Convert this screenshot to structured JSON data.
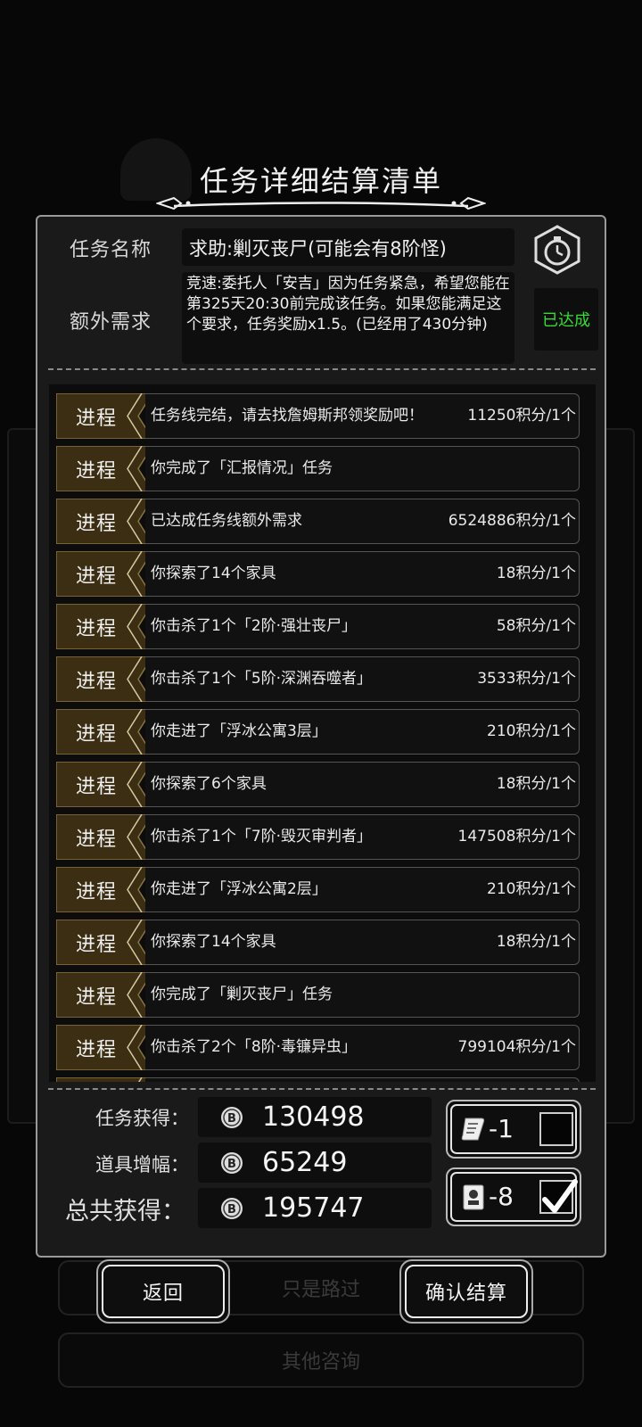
{
  "title": "任务详细结算清单",
  "background": {
    "button_pass": "只是路过",
    "button_other": "其他咨询"
  },
  "task": {
    "name_label": "任务名称",
    "name": "求助:剿灭丧尸(可能会有8阶怪)",
    "extra_label": "额外需求",
    "extra_text": "竞速:委托人「安吉」因为任务紧急，希望您能在第325天20:30前完成该任务。如果您能满足这个要求，任务奖励x1.5。(已经用了430分钟)",
    "status": "已达成"
  },
  "progress_tag": "进程",
  "progress_rows": [
    {
      "text": "任务线完结，请去找詹姆斯邦领奖励吧！",
      "points": "11250积分/1个"
    },
    {
      "text": "你完成了「汇报情况」任务",
      "points": ""
    },
    {
      "text": "已达成任务线额外需求",
      "points": "6524886积分/1个"
    },
    {
      "text": "你探索了14个家具",
      "points": "18积分/1个"
    },
    {
      "text": "你击杀了1个「2阶·强壮丧尸」",
      "points": "58积分/1个"
    },
    {
      "text": "你击杀了1个「5阶·深渊吞噬者」",
      "points": "3533积分/1个"
    },
    {
      "text": "你走进了「浮冰公寓3层」",
      "points": "210积分/1个"
    },
    {
      "text": "你探索了6个家具",
      "points": "18积分/1个"
    },
    {
      "text": "你击杀了1个「7阶·毁灭审判者」",
      "points": "147508积分/1个"
    },
    {
      "text": "你走进了「浮冰公寓2层」",
      "points": "210积分/1个"
    },
    {
      "text": "你探索了14个家具",
      "points": "18积分/1个"
    },
    {
      "text": "你完成了「剿灭丧尸」任务",
      "points": ""
    },
    {
      "text": "你击杀了2个「8阶·毒镰异虫」",
      "points": "799104积分/1个"
    }
  ],
  "summary": {
    "task_label": "任务获得：",
    "task_value": "130498",
    "item_label": "道具增幅：",
    "item_value": "65249",
    "total_label": "总共获得：",
    "total_value": "195747"
  },
  "items": [
    {
      "icon": "scroll-icon",
      "count": "-1",
      "checked": false
    },
    {
      "icon": "card-icon",
      "count": "-8",
      "checked": true
    }
  ],
  "buttons": {
    "back": "返回",
    "confirm": "确认结算"
  },
  "colors": {
    "achieved": "#33dd33",
    "tag_brown": "#3b2e12",
    "tag_border": "#8a7440"
  }
}
